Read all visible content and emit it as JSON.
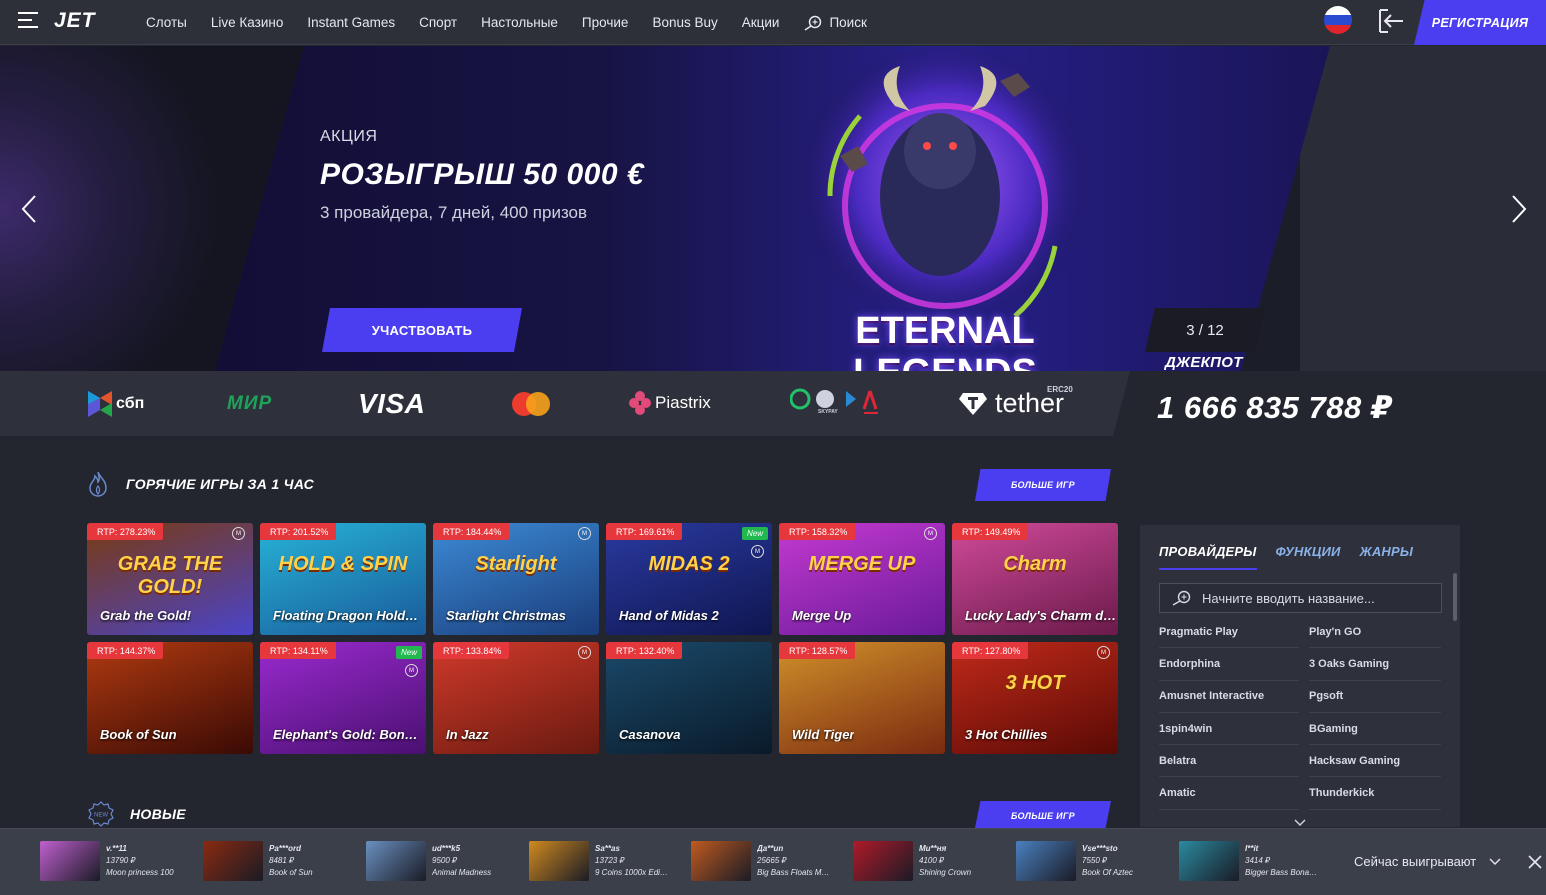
{
  "header": {
    "logo": "JET",
    "nav": [
      "Слоты",
      "Live Казино",
      "Instant Games",
      "Спорт",
      "Настольные",
      "Прочие",
      "Bonus Buy",
      "Акции"
    ],
    "search_label": "Поиск",
    "register_label": "РЕГИСТРАЦИЯ"
  },
  "hero": {
    "tag": "АКЦИЯ",
    "title": "РОЗЫГРЫШ 50 000 €",
    "subtitle": "3 провайдера, 7 дней, 400 призов",
    "cta": "УЧАСТВОВАТЬ",
    "art_title_line1": "ETERNAL",
    "art_title_line2": "LEGENDS",
    "counter": "3 / 12"
  },
  "payments": {
    "sbp": "сбп",
    "mir": "МИР",
    "visa": "VISA",
    "piastrix": "Piastrix",
    "tether": "tether",
    "tether_sup": "ERC20",
    "skypay": "SKYPAY"
  },
  "jackpot": {
    "label": "ДЖЕКПОТ",
    "value": "1 666 835 788 ₽"
  },
  "hot_games": {
    "title": "ГОРЯЧИЕ ИГРЫ ЗА 1 ЧАС",
    "more": "БОЛЬШЕ ИГР",
    "games": [
      {
        "rtp": "RTP: 278.23%",
        "name": "Grab the Gold!",
        "art": "GRAB THE GOLD!",
        "color1": "#7a3a10",
        "color2": "#4a44c9",
        "badge": "m"
      },
      {
        "rtp": "RTP: 201.52%",
        "name": "Floating Dragon Hold…",
        "art": "HOLD & SPIN",
        "color1": "#26b3d6",
        "color2": "#1a5a9a",
        "badge": ""
      },
      {
        "rtp": "RTP: 184.44%",
        "name": "Starlight Christmas",
        "art": "Starlight",
        "color1": "#3c8bd6",
        "color2": "#1a3c7a",
        "badge": "m"
      },
      {
        "rtp": "RTP: 169.61%",
        "name": "Hand of Midas 2",
        "art": "MIDAS 2",
        "color1": "#2a3aa0",
        "color2": "#0f1650",
        "badge": "new"
      },
      {
        "rtp": "RTP: 158.32%",
        "name": "Merge Up",
        "art": "MERGE UP",
        "color1": "#c43ad0",
        "color2": "#6a1a9a",
        "badge": "m"
      },
      {
        "rtp": "RTP: 149.49%",
        "name": "Lucky Lady's Charm d…",
        "art": "Charm",
        "color1": "#d04a9a",
        "color2": "#6a1a4a",
        "badge": ""
      },
      {
        "rtp": "RTP: 144.37%",
        "name": "Book of Sun",
        "art": "",
        "color1": "#b03a10",
        "color2": "#3a0a05",
        "badge": ""
      },
      {
        "rtp": "RTP: 134.11%",
        "name": "Elephant's Gold: Bon…",
        "art": "",
        "color1": "#9a2ad0",
        "color2": "#4a1070",
        "badge": "new"
      },
      {
        "rtp": "RTP: 133.84%",
        "name": "In Jazz",
        "art": "",
        "color1": "#d03a2a",
        "color2": "#6a1a10",
        "badge": "m"
      },
      {
        "rtp": "RTP: 132.40%",
        "name": "Casanova",
        "art": "",
        "color1": "#1a4a6a",
        "color2": "#0a1a2a",
        "badge": ""
      },
      {
        "rtp": "RTP: 128.57%",
        "name": "Wild Tiger",
        "art": "",
        "color1": "#d0902a",
        "color2": "#7a2a10",
        "badge": ""
      },
      {
        "rtp": "RTP: 127.80%",
        "name": "3 Hot Chillies",
        "art": "3 HOT",
        "color1": "#c02a1a",
        "color2": "#5a0a05",
        "badge": "m"
      }
    ]
  },
  "new_games": {
    "title": "НОВЫЕ",
    "icon_text": "NEW",
    "more": "БОЛЬШЕ ИГР"
  },
  "side": {
    "tabs": [
      "ПРОВАЙДЕРЫ",
      "ФУНКЦИИ",
      "ЖАНРЫ"
    ],
    "search_placeholder": "Начните вводить название...",
    "providers": [
      "Pragmatic Play",
      "Play'n GO",
      "Endorphina",
      "3 Oaks Gaming",
      "Amusnet Interactive",
      "Pgsoft",
      "1spin4win",
      "BGaming",
      "Belatra",
      "Hacksaw Gaming",
      "Amatic",
      "Thunderkick"
    ]
  },
  "winners": {
    "label": "Сейчас выигрывают",
    "items": [
      {
        "user": "v.**11",
        "amount": "13790 ₽",
        "game": "Moon princess 100",
        "color": "#c060d0"
      },
      {
        "user": "Pa***ord",
        "amount": "8481 ₽",
        "game": "Book of Sun",
        "color": "#8a2a10"
      },
      {
        "user": "ud***k5",
        "amount": "9500 ₽",
        "game": "Animal Madness",
        "color": "#6a90c0"
      },
      {
        "user": "Sa**as",
        "amount": "13723 ₽",
        "game": "9 Coins 1000x Edi…",
        "color": "#d08a20"
      },
      {
        "user": "Да**un",
        "amount": "25665 ₽",
        "game": "Big Bass Floats M…",
        "color": "#c05a20"
      },
      {
        "user": "Mu**ня",
        "amount": "4100 ₽",
        "game": "Shining Crown",
        "color": "#b01a2a"
      },
      {
        "user": "Vse***sto",
        "amount": "7550 ₽",
        "game": "Book Of Aztec",
        "color": "#4a80c0"
      },
      {
        "user": "I**it",
        "amount": "3414 ₽",
        "game": "Bigger Bass Bona…",
        "color": "#2a8aa0"
      }
    ]
  }
}
